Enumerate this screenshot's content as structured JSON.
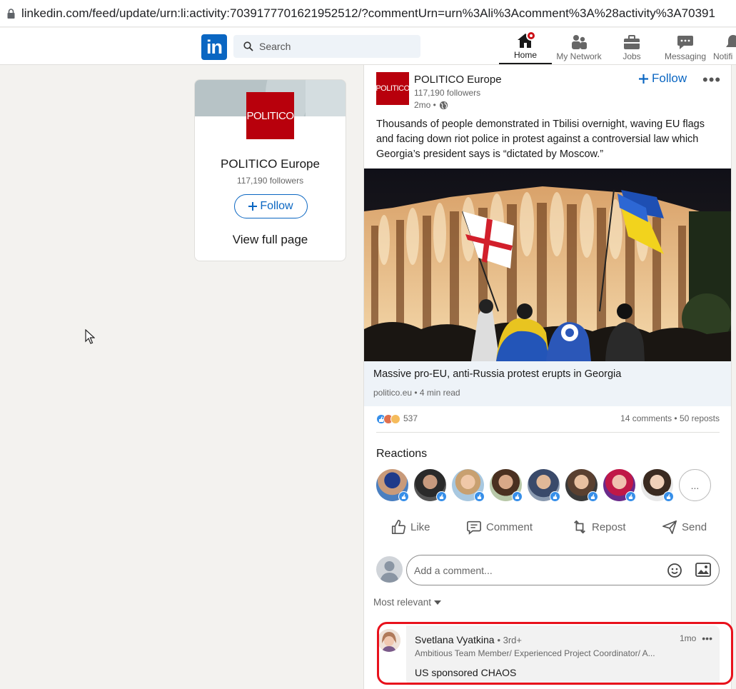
{
  "browser": {
    "url": "linkedin.com/feed/update/urn:li:activity:7039177701621952512/?commentUrn=urn%3Ali%3Acomment%3A%28activity%3A70391"
  },
  "nav": {
    "logo": "in",
    "search_placeholder": "Search",
    "items": [
      {
        "label": "Home",
        "icon": "home-icon"
      },
      {
        "label": "My Network",
        "icon": "network-icon"
      },
      {
        "label": "Jobs",
        "icon": "briefcase-icon"
      },
      {
        "label": "Messaging",
        "icon": "messaging-icon"
      },
      {
        "label": "Notifi",
        "icon": "bell-icon"
      }
    ]
  },
  "company_card": {
    "logo_text": "POLITICO",
    "name": "POLITICO Europe",
    "followers": "117,190 followers",
    "follow_label": "Follow",
    "view_full_page": "View full page"
  },
  "post": {
    "logo_text": "POLITICO",
    "author": "POLITICO Europe",
    "followers": "117,190 followers",
    "time": "2mo •",
    "follow_label": "Follow",
    "more": "•••",
    "text": "Thousands of people demonstrated in Tbilisi overnight, waving EU flags and facing down riot police in protest against a controversial law which Georgia’s president says is “dictated by Moscow.”",
    "link": {
      "title": "Massive pro-EU, anti-Russia protest erupts in Georgia",
      "source": "politico.eu • 4 min read"
    },
    "reaction_count": "537",
    "stats": "14 comments • 50 reposts",
    "reactions_title": "Reactions",
    "more_reactors": "...",
    "actions": {
      "like": "Like",
      "comment": "Comment",
      "repost": "Repost",
      "send": "Send"
    },
    "comment_placeholder": "Add a comment...",
    "sort_label": "Most relevant",
    "colors": {
      "brand": "#0a66c2",
      "politico": "#b8000c",
      "highlight": "#e8111c"
    }
  },
  "comment": {
    "name": "Svetlana Vyatkina",
    "degree": "• 3rd+",
    "time": "1mo",
    "more": "•••",
    "headline": "Ambitious Team Member/ Experienced Project Coordinator/ A...",
    "text": "US sponsored CHAOS"
  }
}
